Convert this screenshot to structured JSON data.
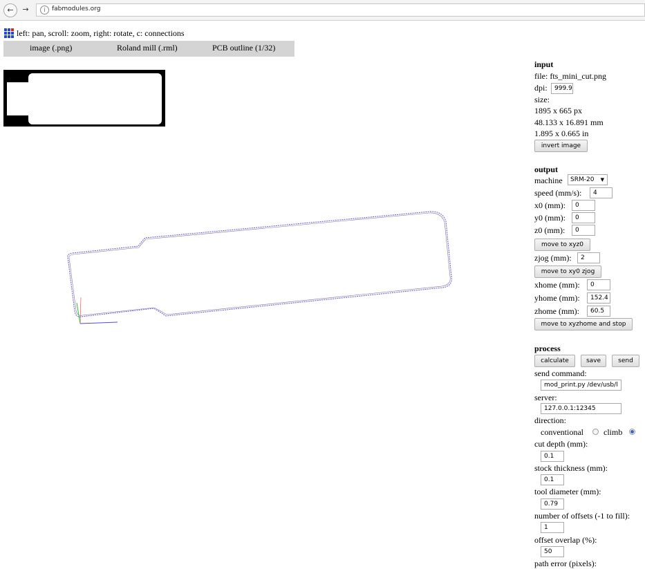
{
  "browser": {
    "back_icon": "back-arrow-icon",
    "forward_icon": "forward-arrow-icon",
    "info_icon": "info-icon",
    "info_glyph": "i",
    "url": "fabmodules.org"
  },
  "header": {
    "logo_icon": "fabmodules-grid-logo-icon",
    "hint": "left: pan, scroll: zoom, right: rotate, c: connections",
    "modules": [
      "image (.png)",
      "Roland mill (.rml)",
      "PCB outline (1/32)"
    ]
  },
  "colors": {
    "module_bar": "#d4d4d4",
    "toolpath": "#5a5ae0",
    "accent_radio": "#3a63c7"
  },
  "input": {
    "heading": "input",
    "file": "file: fts_mini_cut.png",
    "dpi_label": "dpi:",
    "dpi_value": "999.9",
    "size_label": "size:",
    "size_px": "1895 x 665 px",
    "size_mm": "48.133 x 16.891 mm",
    "size_in": "1.895 x 0.665 in",
    "invert_button": "invert image"
  },
  "output": {
    "heading": "output",
    "machine_label": "machine",
    "machine_value": "SRM-20",
    "speed_label": "speed (mm/s):",
    "speed_value": "4",
    "x0_label": "x0 (mm):",
    "x0_value": "0",
    "y0_label": "y0 (mm):",
    "y0_value": "0",
    "z0_label": "z0 (mm):",
    "z0_value": "0",
    "move_xyz0_button": "move to xyz0",
    "zjog_label": "zjog (mm):",
    "zjog_value": "2",
    "move_xy0_zjog_button": "move to xy0 zjog",
    "xhome_label": "xhome (mm):",
    "xhome_value": "0",
    "yhome_label": "yhome (mm):",
    "yhome_value": "152.4",
    "zhome_label": "zhome (mm):",
    "zhome_value": "60.5",
    "move_home_button": "move to xyzhome and stop"
  },
  "process": {
    "heading": "process",
    "calculate_button": "calculate",
    "save_button": "save",
    "send_button": "send",
    "send_command_label": "send command:",
    "send_command_value": "mod_print.py /dev/usb/l",
    "server_label": "server:",
    "server_value": "127.0.0.1:12345",
    "direction_label": "direction:",
    "direction_conventional": "conventional",
    "direction_climb": "climb",
    "direction_selected": "climb",
    "cut_depth_label": "cut depth (mm):",
    "cut_depth_value": "0.1",
    "stock_thickness_label": "stock thickness (mm):",
    "stock_thickness_value": "0.1",
    "tool_diameter_label": "tool diameter (mm):",
    "tool_diameter_value": "0.79",
    "offsets_label": "number of offsets (-1 to fill):",
    "offsets_value": "1",
    "overlap_label": "offset overlap (%):",
    "overlap_value": "50",
    "path_error_label": "path error (pixels):"
  }
}
